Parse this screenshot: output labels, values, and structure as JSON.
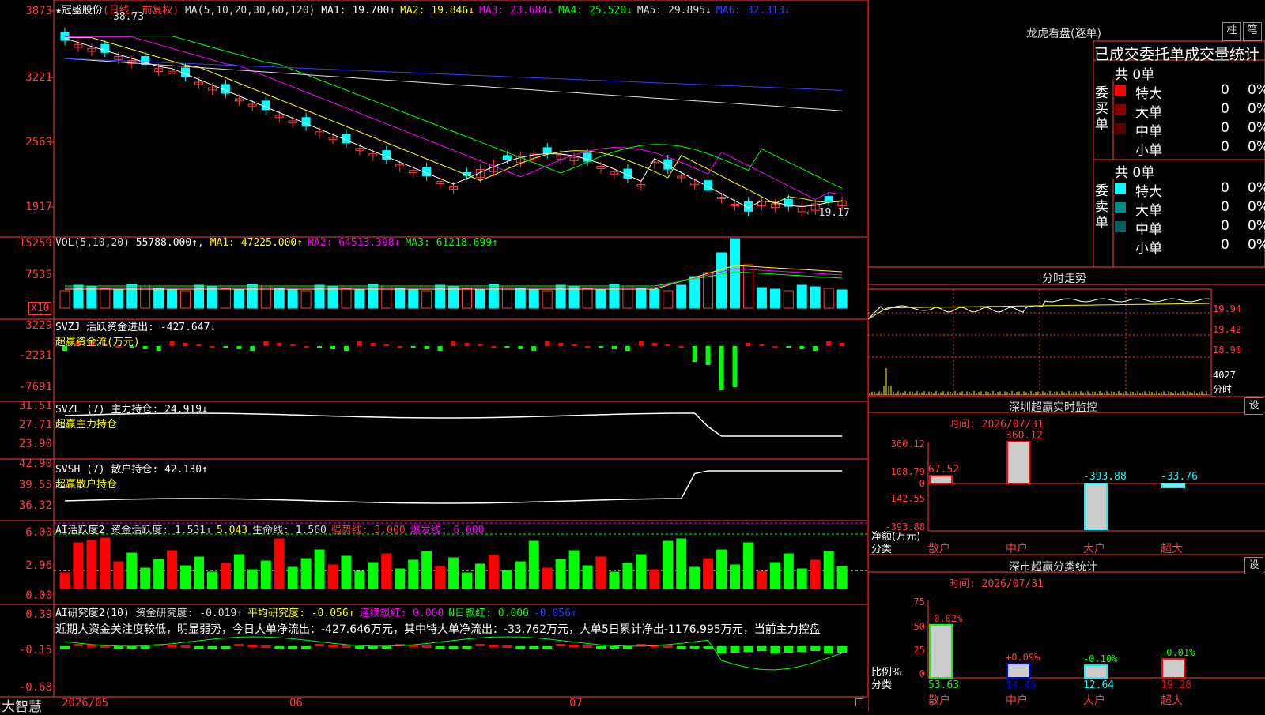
{
  "stock": {
    "name": "冠盛股份",
    "period": "(日线, 前复权)",
    "star": "★"
  },
  "ma_header": {
    "prefix": "MA(5,10,20,30,60,120)",
    "items": [
      {
        "label": "MA1: 19.700↑",
        "color": "#ffffff"
      },
      {
        "label": "MA2: 19.846↓",
        "color": "#ffff00"
      },
      {
        "label": "MA3: 23.684↓",
        "color": "#ff00ff"
      },
      {
        "label": "MA4: 25.520↓",
        "color": "#00ff00"
      },
      {
        "label": "MA5: 29.895↓",
        "color": "#dddddd"
      },
      {
        "label": "MA6: 32.313↓",
        "color": "#3a3aff"
      }
    ]
  },
  "main_axis": [
    "3873",
    "3221",
    "2569",
    "1917"
  ],
  "price_marks": {
    "high": "38.73",
    "low": "← 19.17"
  },
  "vol_header": {
    "prefix": "VOL(5,10,20)",
    "value": "55788.000↑",
    "items": [
      {
        "label": "MA1: 47225.000↑",
        "color": "#ffff00"
      },
      {
        "label": "MA2: 64513.398↓",
        "color": "#ff00ff"
      },
      {
        "label": "MA3: 61218.699↑",
        "color": "#00ff00"
      }
    ]
  },
  "vol_axis": [
    "15259",
    "7535"
  ],
  "vol_unit": "X10",
  "svzj": {
    "line1": "SVZJ  活跃资金进出: -427.647↓",
    "line2": "超赢资金流(万元)",
    "axis": [
      "3229",
      "-2231",
      "-7691"
    ]
  },
  "svzl": {
    "line1": "SVZL (7) 主力持仓: 24.919↓",
    "line2": "超赢主力持仓",
    "axis": [
      "31.51",
      "27.71",
      "23.90"
    ]
  },
  "svsh": {
    "line1": "SVSH (7) 散户持仓: 42.130↑",
    "line2": "超赢散户持仓",
    "axis": [
      "42.90",
      "39.55",
      "36.32"
    ]
  },
  "ai_active": {
    "prefix": "AI活跃度2",
    "items": [
      {
        "label": "资金活跃度: 1.531↑",
        "color": "#dddddd"
      },
      {
        "label": "5.043",
        "color": "#ffff00"
      },
      {
        "label": "生命线: 1.560",
        "color": "#dddddd"
      },
      {
        "label": "强势线: 3.000",
        "color": "#ff3b3b"
      },
      {
        "label": "爆发线: 6.000",
        "color": "#ff00ff"
      }
    ],
    "axis": [
      "6.00",
      "2.96",
      "0.00"
    ]
  },
  "ai_research": {
    "prefix": "AI研究度2(10)",
    "items": [
      {
        "label": "资金研究度: -0.019↑",
        "color": "#dddddd"
      },
      {
        "label": "平均研究度: -0.056↑",
        "color": "#ffff00"
      },
      {
        "label": "连续飘红: 0.000",
        "color": "#ff00ff"
      },
      {
        "label": "N日飘红: 0.000",
        "color": "#00ff00"
      },
      {
        "label": "-0.056↑",
        "color": "#3a3aff"
      }
    ],
    "axis": [
      "0.39",
      "-0.15",
      "-0.68"
    ],
    "message": "近期大资金关注度较低，明显弱势，今日大单净流出：-427.646万元，其中特大单净流出：-33.762万元，大单5日累计净出-1176.995万元，当前主力控盘"
  },
  "footer": {
    "brand": "大智慧",
    "dates": [
      "2026/05",
      "06",
      "07"
    ]
  },
  "dragon": {
    "title": "龙虎看盘(逐单)",
    "btn1": "柱",
    "btn2": "笔",
    "subtitle": "已成交委托单成交量统计",
    "buy": {
      "label": "委买单",
      "total": "共 0单",
      "rows": [
        {
          "name": "特大",
          "vol": "0",
          "pct": "0%",
          "color": "#ff0000"
        },
        {
          "name": "大单",
          "vol": "0",
          "pct": "0%",
          "color": "#8b0000"
        },
        {
          "name": "中单",
          "vol": "0",
          "pct": "0%",
          "color": "#5a0000"
        },
        {
          "name": "小单",
          "vol": "0",
          "pct": "0%",
          "color": ""
        }
      ]
    },
    "sell": {
      "label": "委卖单",
      "total": "共 0单",
      "rows": [
        {
          "name": "特大",
          "vol": "0",
          "pct": "0%",
          "color": "#00ffff"
        },
        {
          "name": "大单",
          "vol": "0",
          "pct": "0%",
          "color": "#008b8b"
        },
        {
          "name": "中单",
          "vol": "0",
          "pct": "0%",
          "color": "#006060"
        },
        {
          "name": "小单",
          "vol": "0",
          "pct": "0%",
          "color": ""
        }
      ]
    }
  },
  "intraday": {
    "title": "分时走势",
    "axis": [
      "19.94",
      "19.42",
      "18.90",
      "4027",
      "分时"
    ]
  },
  "sz_monitor": {
    "title": "深圳超赢实时监控",
    "btn": "设",
    "time": "时间: 2026/07/31",
    "axis": [
      "360.12",
      "108.79",
      "0",
      "-142.55",
      "-393.88"
    ],
    "ylabel": "净额(万元)",
    "xlabel": "分类",
    "bars": [
      {
        "name": "散户",
        "value": 67.52,
        "label": "67.52"
      },
      {
        "name": "中户",
        "value": 360.12,
        "label": "360.12"
      },
      {
        "name": "大户",
        "value": -393.88,
        "label": "-393.88"
      },
      {
        "name": "超大",
        "value": -33.76,
        "label": "-33.76"
      }
    ]
  },
  "sz_class": {
    "title": "深市超赢分类统计",
    "btn": "设",
    "time": "时间: 2026/07/31",
    "axis": [
      "75",
      "50",
      "25",
      "0"
    ],
    "ylabel": "比例%",
    "xlabel": "分类",
    "bars": [
      {
        "name": "散户",
        "value": 53.63,
        "top": "+0.02%",
        "color": "#00ff00"
      },
      {
        "name": "中户",
        "value": 14.45,
        "top": "+0.09%",
        "color": "#0000ff"
      },
      {
        "name": "大户",
        "value": 12.64,
        "top": "-0.10%",
        "color": "#00ffff"
      },
      {
        "name": "超大",
        "value": 19.28,
        "top": "-0.01%",
        "color": "#ff0000"
      }
    ]
  }
}
